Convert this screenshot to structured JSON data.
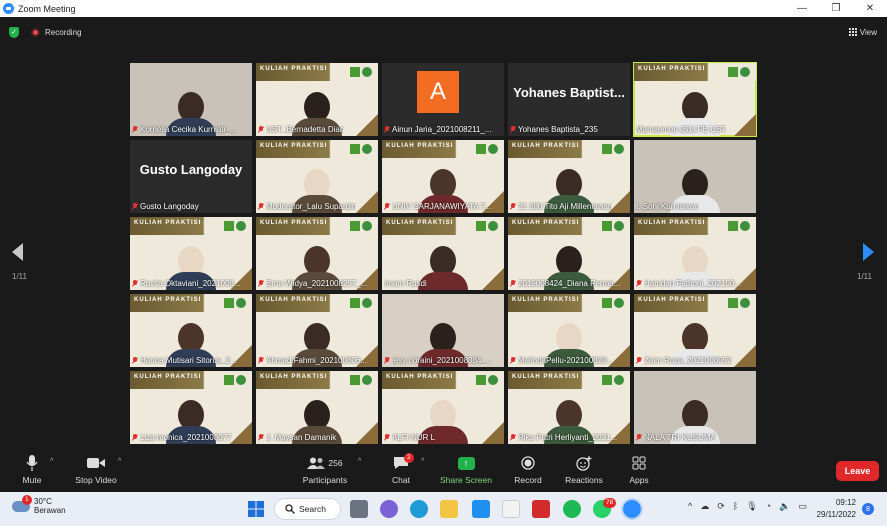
{
  "window": {
    "title": "Zoom Meeting",
    "minimize": "—",
    "maximize": "❐",
    "close": "✕"
  },
  "topbar": {
    "recording": "Recording",
    "view": "View"
  },
  "slide_text": "KULIAH PRAKTISI",
  "participants": [
    {
      "name": "Kornelia  Cecika Kurniati_...",
      "muted": true,
      "kind": "cam"
    },
    {
      "name": "UST_Bernadetta Dian",
      "muted": true,
      "kind": "slide"
    },
    {
      "name": "Ainun Jaria_2021008211_...",
      "muted": true,
      "kind": "avatar",
      "initial": "A"
    },
    {
      "name": "Yohanes Baptista_235",
      "muted": true,
      "kind": "plain",
      "big_name": "Yohanes  Baptist..."
    },
    {
      "name": "Manajemen (S1) FE-UST",
      "muted": false,
      "kind": "slide",
      "active": true
    },
    {
      "name": "Gusto Langoday",
      "muted": true,
      "kind": "plain",
      "big_name": "Gusto Langoday"
    },
    {
      "name": "Moderator_Lalu Supardin",
      "muted": true,
      "kind": "slide"
    },
    {
      "name": "UNIV SARJANAWIYATA T...",
      "muted": true,
      "kind": "slide"
    },
    {
      "name": "21 280 Tito Aji Milleniawan",
      "muted": true,
      "kind": "slide"
    },
    {
      "name": "I. Soni Kurniawan",
      "muted": false,
      "kind": "cam"
    },
    {
      "name": "Ruvita Oktaviani_2021008...",
      "muted": true,
      "kind": "slide"
    },
    {
      "name": "Erna Widya_2021008257_...",
      "muted": true,
      "kind": "slide"
    },
    {
      "name": "Imam Rusdi",
      "muted": false,
      "kind": "slide"
    },
    {
      "name": "2019008424_Diana Perma...",
      "muted": true,
      "kind": "slide"
    },
    {
      "name": "Hamdan Fathoni_202100...",
      "muted": true,
      "kind": "slide"
    },
    {
      "name": "Hanna Mutisari Sitorus_2...",
      "muted": true,
      "kind": "slide"
    },
    {
      "name": "Ahmad Fahmi_202100806...",
      "muted": true,
      "kind": "slide"
    },
    {
      "name": "jesy noraini_2021008084_...",
      "muted": true,
      "kind": "cam"
    },
    {
      "name": "MelindaPellu-202100820...",
      "muted": true,
      "kind": "slide"
    },
    {
      "name": "Zaim Roza_2021008052",
      "muted": true,
      "kind": "slide"
    },
    {
      "name": "Liza monica_2021008077",
      "muted": true,
      "kind": "slide"
    },
    {
      "name": "J. Maysan Damanik",
      "muted": true,
      "kind": "slide"
    },
    {
      "name": "ALFI  NUR L",
      "muted": true,
      "kind": "slide"
    },
    {
      "name": "Rika Putri Herliyanti_2021...",
      "muted": true,
      "kind": "slide"
    },
    {
      "name": "NALA TRI KUSUMA",
      "muted": true,
      "kind": "cam"
    }
  ],
  "pager": {
    "left": "1/11",
    "right": "1/11"
  },
  "toolbar": {
    "mute": "Mute",
    "stop_video": "Stop Video",
    "participants_label": "Participants",
    "participants_count": "256",
    "chat": "Chat",
    "chat_badge": "2",
    "share": "Share Screen",
    "record": "Record",
    "reactions": "Reactions",
    "apps": "Apps",
    "leave": "Leave"
  },
  "taskbar": {
    "temp": "30°C",
    "weather": "Berawan",
    "search": "Search",
    "whatsapp_badge": "78",
    "time": "09:12",
    "date": "29/11/2022",
    "notif": "8"
  },
  "colors": {
    "active_border": "#c9e94a",
    "leave": "#e02828",
    "share": "#23b14d",
    "accent": "#2d8cff"
  }
}
